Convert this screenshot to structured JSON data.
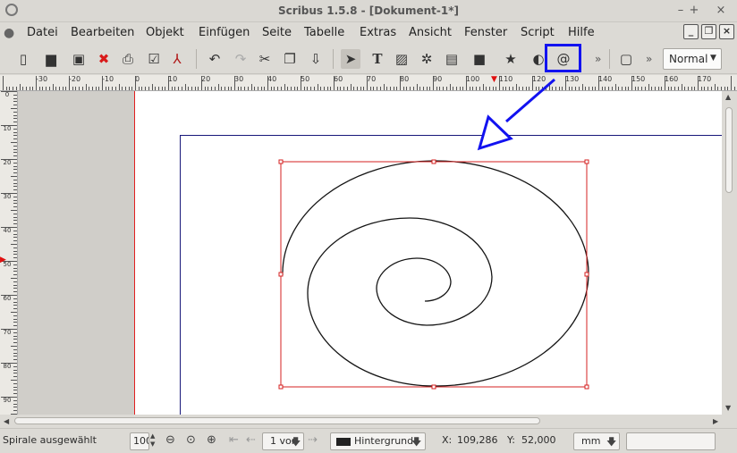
{
  "window": {
    "title": "Scribus 1.5.8 - [Dokument-1*]",
    "minimize": "–",
    "maximize": "+",
    "close": "×"
  },
  "menu": {
    "items": [
      "Datei",
      "Bearbeiten",
      "Objekt",
      "Einfügen",
      "Seite",
      "Tabelle",
      "Extras",
      "Ansicht",
      "Fenster",
      "Script",
      "Hilfe"
    ]
  },
  "toolbar": {
    "overflow_label": "»",
    "mode_select": "Normal",
    "icons": [
      "new-document-icon",
      "open-document-icon",
      "save-icon",
      "close-document-icon",
      "print-icon",
      "preflight-check-icon",
      "export-pdf-icon",
      "undo-icon",
      "redo-icon",
      "cut-icon",
      "copy-icon",
      "paste-icon",
      "select-tool-icon",
      "text-frame-icon",
      "image-frame-icon",
      "render-frame-icon",
      "table-icon",
      "shape-icon",
      "polygon-icon",
      "arc-icon",
      "spiral-icon",
      "frame-toggle-icon"
    ],
    "highlighted_tool": "spiral-icon"
  },
  "ruler": {
    "h_labels": [
      "-30",
      "-20",
      "-10",
      "0",
      "10",
      "20",
      "30",
      "40",
      "50",
      "60",
      "70",
      "80",
      "90",
      "100",
      "110",
      "120",
      "130",
      "140",
      "150",
      "160",
      "170"
    ],
    "v_labels": [
      "0",
      "10",
      "20",
      "30",
      "40",
      "50",
      "60",
      "70",
      "80",
      "90"
    ]
  },
  "annotation": {
    "arrow_color": "#1212f0"
  },
  "colors": {
    "selection": "#d42020",
    "margin_guide": "#17177a",
    "highlight": "#1212f0"
  },
  "status": {
    "selection_text": "Spirale ausgewählt : C",
    "zoom_value": "100",
    "page_value": "1 von",
    "layer_value": "Hintergrund",
    "x_label": "X:",
    "x_value": "109,286",
    "y_label": "Y:",
    "y_value": "52,000",
    "unit": "mm"
  }
}
